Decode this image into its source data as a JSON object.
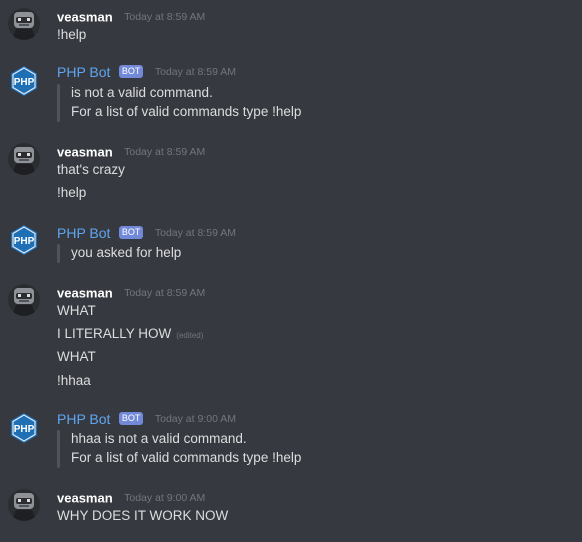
{
  "icons": {
    "user_avatar": "robot-avatar-icon",
    "bot_avatar": "php-logo-icon"
  },
  "colors": {
    "background": "#36393f",
    "bot_name": "#5fa6f0",
    "badge": "#7289da",
    "timestamp": "#72767d",
    "text": "#dcddde"
  },
  "messages": [
    {
      "author": "veasman",
      "time": "Today at 8:59 AM",
      "lines": [
        "!help"
      ]
    },
    {
      "author": "PHP Bot",
      "badge": "BOT",
      "time": "Today at 8:59 AM",
      "quote": [
        " is not a valid command.",
        "For a list of valid commands type !help"
      ]
    },
    {
      "author": "veasman",
      "time": "Today at 8:59 AM",
      "lines": [
        "that's  crazy",
        "!help"
      ]
    },
    {
      "author": "PHP Bot",
      "badge": "BOT",
      "time": "Today at 8:59 AM",
      "quote": [
        "you asked for help"
      ]
    },
    {
      "author": "veasman",
      "time": "Today at 8:59 AM",
      "lines": [
        "WHAT",
        "I LITERALLY HOW",
        "WHAT",
        "!hhaa"
      ],
      "edited": "(edited)"
    },
    {
      "author": "PHP Bot",
      "badge": "BOT",
      "time": "Today at 9:00 AM",
      "quote": [
        "hhaa is not a valid command.",
        "For a list of valid commands type !help"
      ]
    },
    {
      "author": "veasman",
      "time": "Today at 9:00 AM",
      "lines": [
        "WHY DOES IT WORK NOW"
      ]
    }
  ]
}
